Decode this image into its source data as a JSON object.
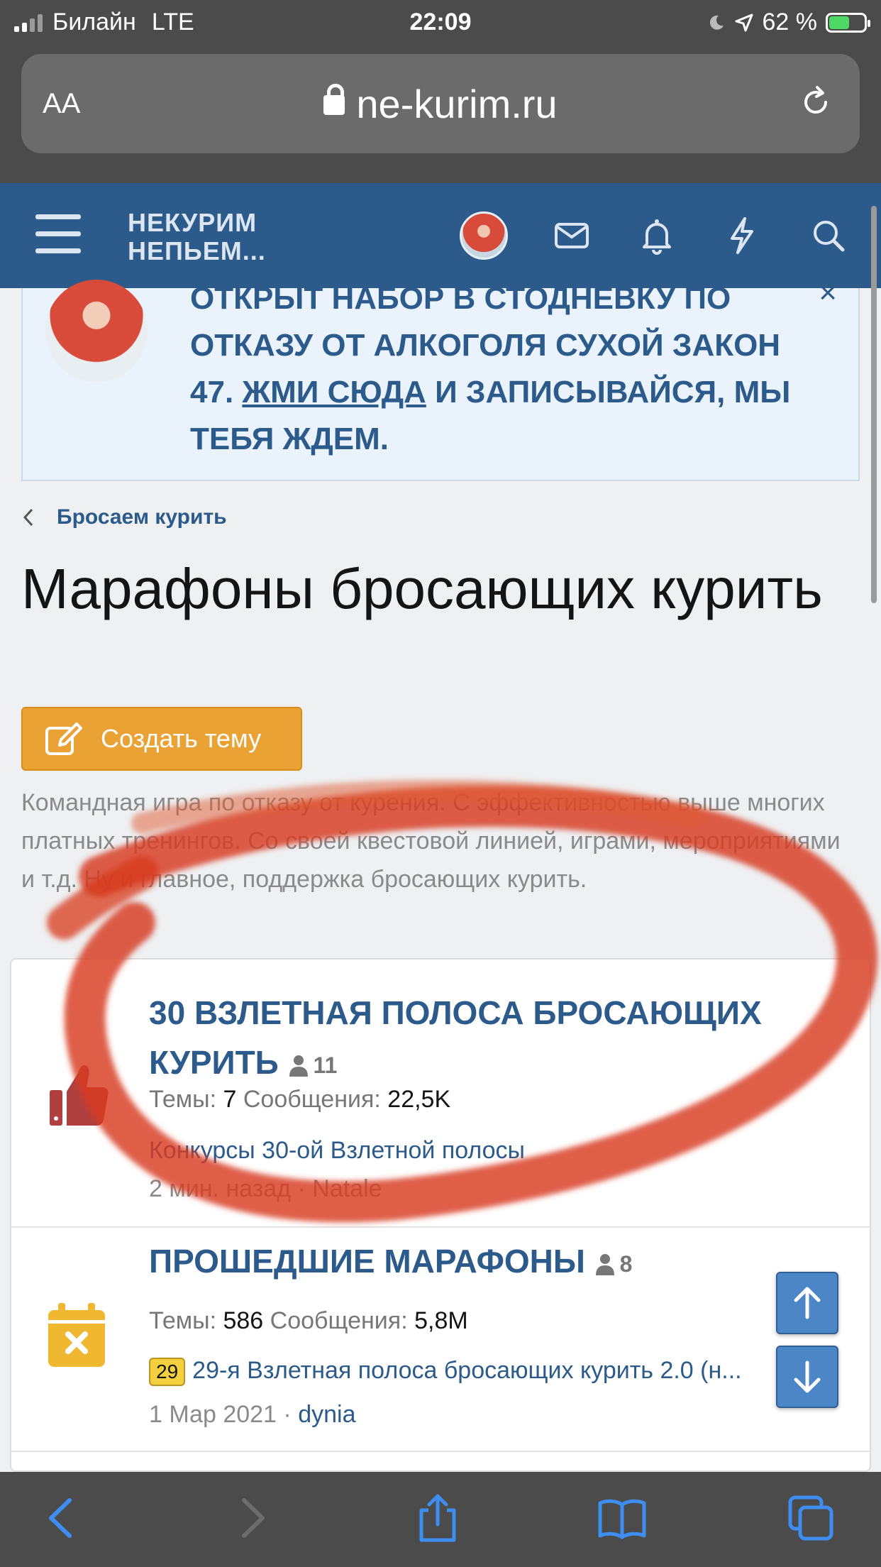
{
  "status_bar": {
    "carrier": "Билайн",
    "network": "LTE",
    "time": "22:09",
    "battery": "62 %",
    "battery_level": 0.62
  },
  "browser": {
    "aa_label": "AA",
    "url": "ne-kurim.ru"
  },
  "site": {
    "logo_line1": "НЕКУРИМ",
    "logo_line2": "НЕПЬЕМ..."
  },
  "notice": {
    "text_before": "ОТКРЫТ НАБОР В СТОДНЕВКУ ПО ОТКАЗУ ОТ АЛКОГОЛЯ СУХОЙ ЗАКОН 47. ",
    "link": "ЖМИ СЮДА",
    "text_after": " И ЗАПИСЫВАЙСЯ, МЫ ТЕБЯ ЖДЕМ.",
    "close": "×"
  },
  "breadcrumb": {
    "label": "Бросаем курить"
  },
  "page": {
    "title": "Марафоны бросающих курить",
    "create_button": "Создать тему",
    "description": "Командная игра по отказу от курения. С эффективностью выше многих платных тренингов. Со своей квестовой линией, играми, мероприятиями и т.д. Ну и главное, поддержка бросающих курить."
  },
  "forums": [
    {
      "title": "30 ВЗЛЕТНАЯ ПОЛОСА БРОСАЮЩИХ КУРИТЬ",
      "users": "11",
      "topics_label": "Темы:",
      "topics": "7",
      "messages_label": "Сообщения:",
      "messages": "22,5K",
      "last_post": "Конкурсы 30-ой Взлетной полосы",
      "last_time": "2 мин. назад",
      "separator": "·",
      "last_user": "Natale",
      "icon": "thumbs-up-icon",
      "icon_color": "#b04040"
    },
    {
      "title": "ПРОШЕДШИЕ МАРАФОНЫ",
      "users": "8",
      "topics_label": "Темы:",
      "topics": "586",
      "messages_label": "Сообщения:",
      "messages": "5,8M",
      "prefix": "29",
      "last_post": "29-я Взлетная полоса бросающих курить 2.0 (н...",
      "last_time": "1 Мар 2021",
      "separator": "·",
      "last_user": "dynia",
      "icon": "calendar-x-icon",
      "icon_color": "#f0b830"
    }
  ],
  "colors": {
    "brand_blue": "#2b5a8b",
    "button_orange": "#eba234",
    "annotation_red": "#d83a1e"
  }
}
